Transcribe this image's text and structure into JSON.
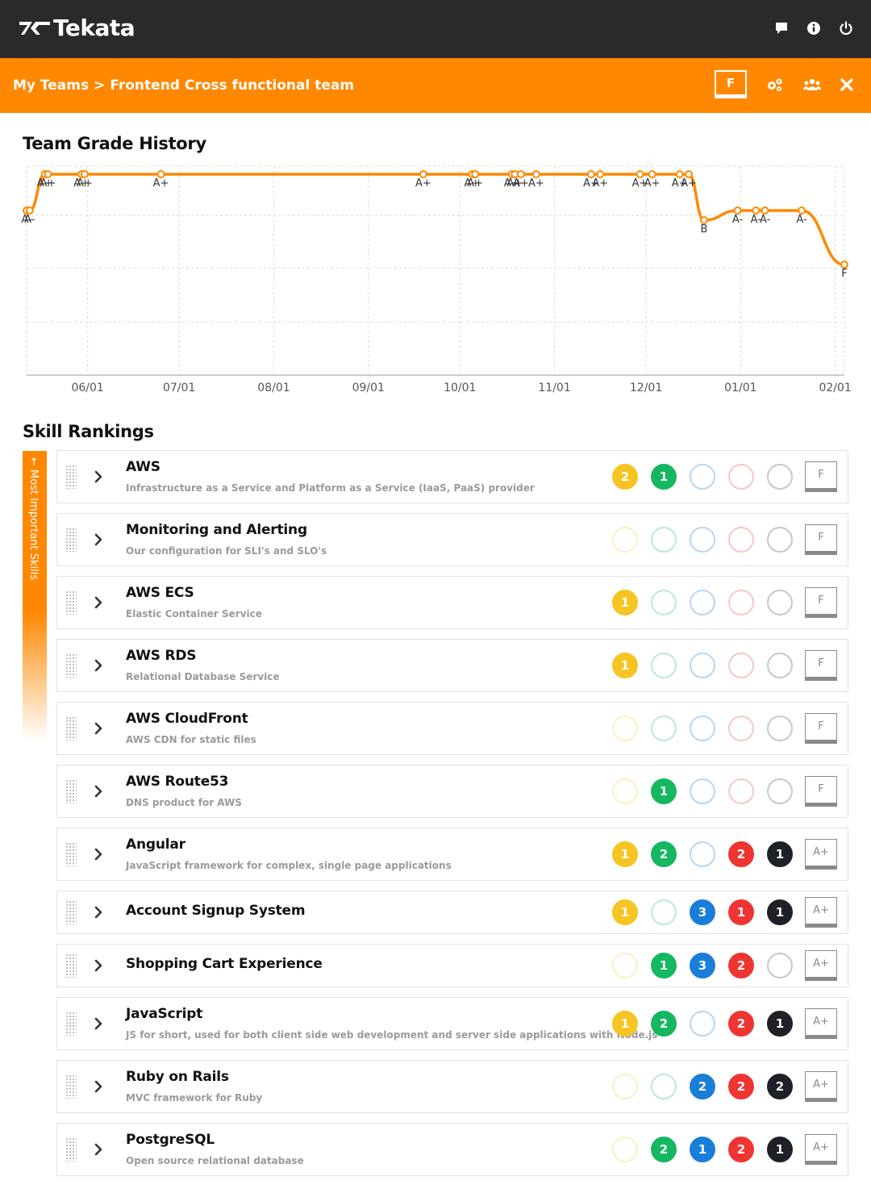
{
  "header": {
    "logo_text": "Tekata",
    "icons": [
      "chat-icon",
      "info-icon",
      "power-icon"
    ]
  },
  "subheader": {
    "breadcrumb_root": "My Teams",
    "breadcrumb_separator": ">",
    "breadcrumb_current": "Frontend Cross functional team",
    "team_grade": "F",
    "icons": [
      "settings-icon",
      "team-members-icon",
      "close-icon"
    ],
    "accent_color": "#ff8800"
  },
  "history": {
    "title": "Team Grade History",
    "chart_data": {
      "type": "line",
      "title": "Team Grade History",
      "xlabel": "",
      "ylabel": "",
      "x_ticks": [
        "06/01",
        "07/01",
        "08/01",
        "09/01",
        "10/01",
        "11/01",
        "12/01",
        "01/01",
        "02/01"
      ],
      "y_ticks_shown": false,
      "grid": true,
      "line_color": "#ff8800",
      "points": [
        {
          "x": "05/12",
          "grade": "A-"
        },
        {
          "x": "05/13",
          "grade": "A-"
        },
        {
          "x": "05/18",
          "grade": "A+"
        },
        {
          "x": "05/19",
          "grade": "A+"
        },
        {
          "x": "05/30",
          "grade": "A+"
        },
        {
          "x": "05/31",
          "grade": "A+"
        },
        {
          "x": "06/25",
          "grade": "A+"
        },
        {
          "x": "09/19",
          "grade": "A+"
        },
        {
          "x": "10/05",
          "grade": "A+"
        },
        {
          "x": "10/06",
          "grade": "A+"
        },
        {
          "x": "10/18",
          "grade": "A+"
        },
        {
          "x": "10/19",
          "grade": "A+"
        },
        {
          "x": "10/21",
          "grade": "A+"
        },
        {
          "x": "10/26",
          "grade": "A+"
        },
        {
          "x": "11/13",
          "grade": "A+"
        },
        {
          "x": "11/16",
          "grade": "A+"
        },
        {
          "x": "11/29",
          "grade": "A+"
        },
        {
          "x": "12/03",
          "grade": "A+"
        },
        {
          "x": "12/12",
          "grade": "A+"
        },
        {
          "x": "12/15",
          "grade": "A+"
        },
        {
          "x": "12/20",
          "grade": "B"
        },
        {
          "x": "12/31",
          "grade": "A-"
        },
        {
          "x": "01/06",
          "grade": "A-"
        },
        {
          "x": "01/09",
          "grade": "A-"
        },
        {
          "x": "01/21",
          "grade": "A-"
        },
        {
          "x": "02/04",
          "grade": "F"
        }
      ]
    }
  },
  "skills": {
    "title": "Skill Rankings",
    "rail_label": "← Most Important Skills",
    "level_colors": [
      "#f6c524",
      "#15b760",
      "#1a7ed9",
      "#ee3531",
      "#1e2128"
    ],
    "level_empty_borders": [
      "#fcefc2",
      "#bde9d4",
      "#b9d6ef",
      "#f6c7c6",
      "#c8c8c8"
    ],
    "items": [
      {
        "name": "AWS",
        "description": "Infrastructure as a Service and Platform as a Service (IaaS, PaaS) provider",
        "counts": [
          2,
          1,
          0,
          0,
          0
        ],
        "grade": "F"
      },
      {
        "name": "Monitoring and Alerting",
        "description": "Our configuration for SLI's and SLO's",
        "counts": [
          0,
          0,
          0,
          0,
          0
        ],
        "grade": "F"
      },
      {
        "name": "AWS ECS",
        "description": "Elastic Container Service",
        "counts": [
          1,
          0,
          0,
          0,
          0
        ],
        "grade": "F"
      },
      {
        "name": "AWS RDS",
        "description": "Relational Database Service",
        "counts": [
          1,
          0,
          0,
          0,
          0
        ],
        "grade": "F"
      },
      {
        "name": "AWS CloudFront",
        "description": "AWS CDN for static files",
        "counts": [
          0,
          0,
          0,
          0,
          0
        ],
        "grade": "F"
      },
      {
        "name": "AWS Route53",
        "description": "DNS product for AWS",
        "counts": [
          0,
          1,
          0,
          0,
          0
        ],
        "grade": "F"
      },
      {
        "name": "Angular",
        "description": "JavaScript framework for complex, single page applications",
        "counts": [
          1,
          2,
          0,
          2,
          1
        ],
        "grade": "A+"
      },
      {
        "name": "Account Signup System",
        "description": "",
        "counts": [
          1,
          0,
          3,
          1,
          1
        ],
        "grade": "A+"
      },
      {
        "name": "Shopping Cart Experience",
        "description": "",
        "counts": [
          0,
          1,
          3,
          2,
          0
        ],
        "grade": "A+"
      },
      {
        "name": "JavaScript",
        "description": "JS for short, used for both client side web development and server side applications with Node.js",
        "counts": [
          1,
          2,
          0,
          2,
          1
        ],
        "grade": "A+"
      },
      {
        "name": "Ruby on Rails",
        "description": "MVC framework for Ruby",
        "counts": [
          0,
          0,
          2,
          2,
          2
        ],
        "grade": "A+"
      },
      {
        "name": "PostgreSQL",
        "description": "Open source relational database",
        "counts": [
          0,
          2,
          1,
          2,
          1
        ],
        "grade": "A+"
      }
    ]
  }
}
